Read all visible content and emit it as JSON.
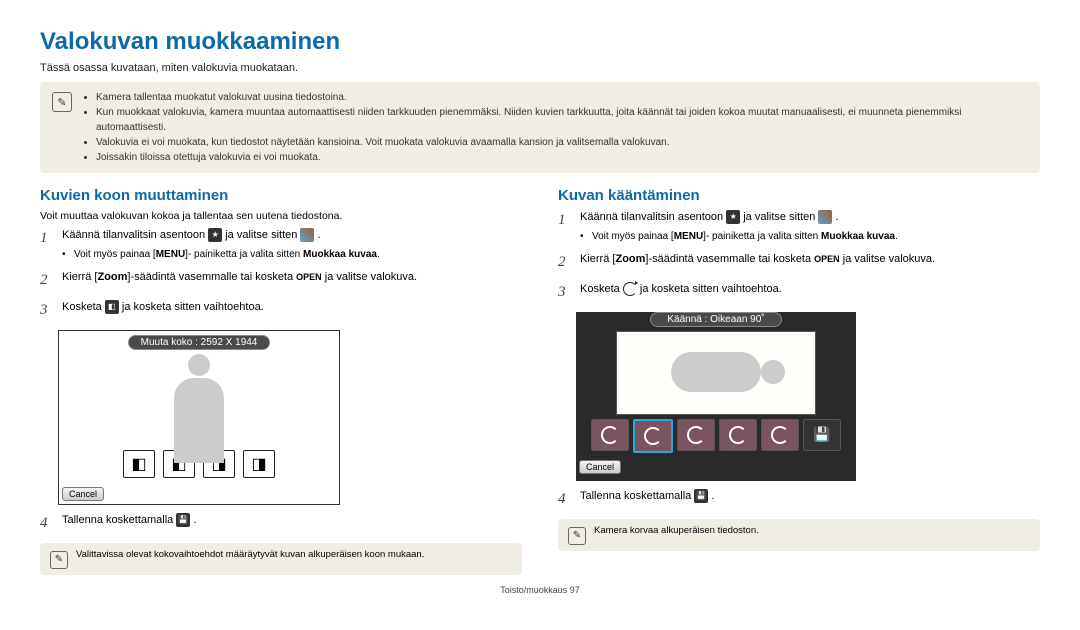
{
  "title": "Valokuvan muokkaaminen",
  "intro": "Tässä osassa kuvataan, miten valokuvia muokataan.",
  "main_callout": {
    "bullets": [
      "Kamera tallentaa muokatut valokuvat uusina tiedostoina.",
      "Kun muokkaat valokuvia, kamera muuntaa automaattisesti niiden tarkkuuden pienemmäksi. Niiden kuvien tarkkuutta, joita käännät tai joiden kokoa muutat manuaalisesti, ei muunneta pienemmiksi automaattisesti.",
      "Valokuvia ei voi muokata, kun tiedostot näytetään kansioina. Voit muokata valokuvia avaamalla kansion ja valitsemalla valokuvan.",
      "Joissakin tiloissa otettuja valokuvia ei voi muokata."
    ]
  },
  "left": {
    "heading": "Kuvien koon muuttaminen",
    "intro": "Voit muuttaa valokuvan kokoa ja tallentaa sen uutena tiedostona.",
    "steps": {
      "s1a": "Käännä tilanvalitsin asentoon ",
      "s1b": " ja valitse sitten ",
      "s1c": ".",
      "s1_bullet_a": "Voit myös painaa [",
      "s1_menu": "MENU",
      "s1_bullet_b": "]- painiketta ja valita sitten ",
      "s1_bold": "Muokkaa kuvaa",
      "s1_bullet_c": ".",
      "s2a": "Kierrä [",
      "s2_zoom": "Zoom",
      "s2b": "]-säädintä vasemmalle tai kosketa ",
      "s2_open": "OPEN",
      "s2c": " ja valitse valokuva.",
      "s3a": "Kosketa ",
      "s3b": " ja kosketa sitten vaihtoehtoa.",
      "screenshot_label": "Muuta koko : 2592 X 1944",
      "cancel": "Cancel",
      "s4a": "Tallenna koskettamalla ",
      "s4b": "."
    },
    "footer_tip": "Valittavissa olevat kokovaihtoehdot määräytyvät kuvan alkuperäisen koon mukaan."
  },
  "right": {
    "heading": "Kuvan kääntäminen",
    "steps": {
      "s1a": "Käännä tilanvalitsin asentoon ",
      "s1b": " ja valitse sitten ",
      "s1c": ".",
      "s1_bullet_a": "Voit myös painaa [",
      "s1_menu": "MENU",
      "s1_bullet_b": "]- painiketta ja valita sitten ",
      "s1_bold": "Muokkaa kuvaa",
      "s1_bullet_c": ".",
      "s2a": "Kierrä [",
      "s2_zoom": "Zoom",
      "s2b": "]-säädintä vasemmalle tai kosketa ",
      "s2_open": "OPEN",
      "s2c": " ja valitse valokuva.",
      "s3a": "Kosketa ",
      "s3b": " ja kosketa sitten vaihtoehtoa.",
      "screenshot_label": "Käännä : Oikeaan 90˚",
      "cancel": "Cancel",
      "s4a": "Tallenna koskettamalla ",
      "s4b": "."
    },
    "footer_tip": "Kamera korvaa alkuperäisen tiedoston."
  },
  "footer": "Toisto/muokkaus  97"
}
